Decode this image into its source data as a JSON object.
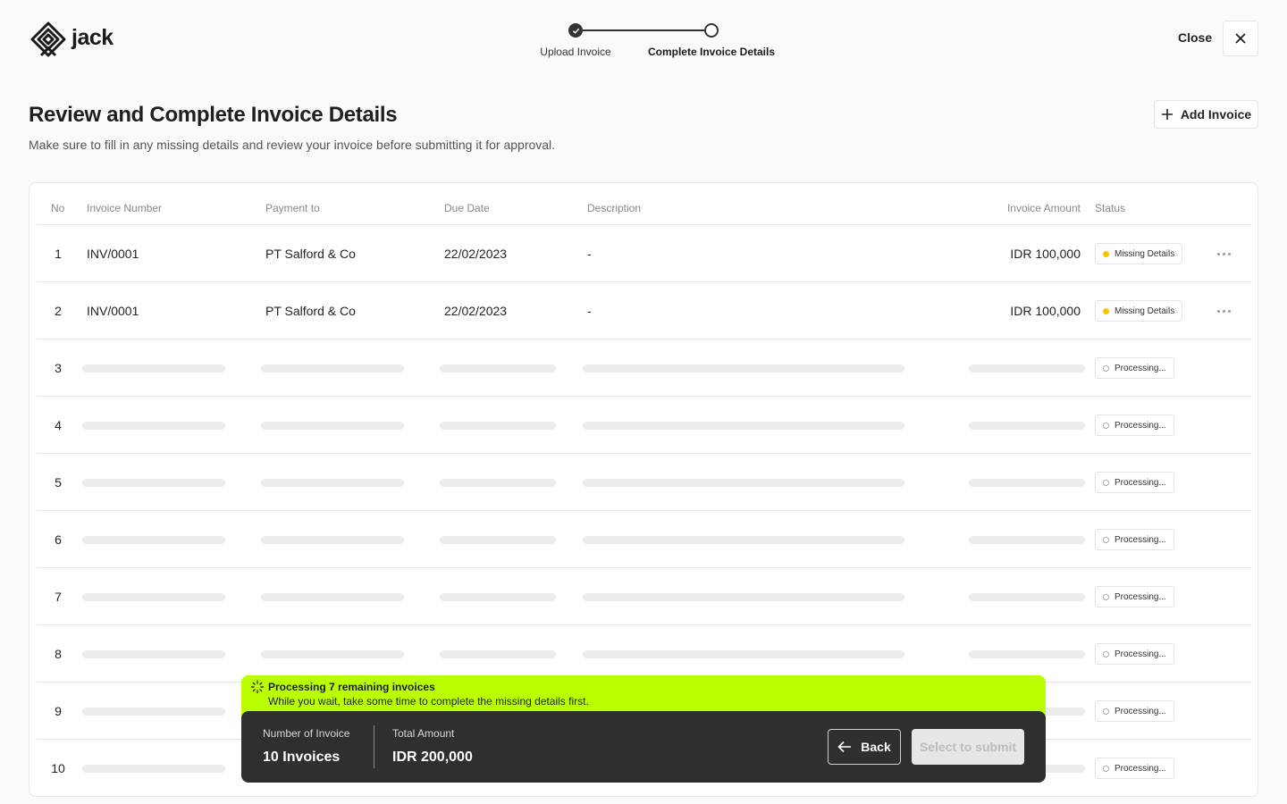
{
  "app": {
    "name": "jack"
  },
  "header": {
    "steps": [
      {
        "label": "Upload Invoice",
        "state": "done"
      },
      {
        "label": "Complete Invoice Details",
        "state": "current"
      }
    ],
    "close_label": "Close"
  },
  "page": {
    "title": "Review and Complete Invoice Details",
    "subtitle": "Make sure to fill in any missing details and review your invoice before submitting it for approval.",
    "add_button": "Add Invoice"
  },
  "table": {
    "columns": [
      "No",
      "Invoice Number",
      "Payment to",
      "Due Date",
      "Description",
      "Invoice Amount",
      "Status"
    ],
    "rows": [
      {
        "no": "1",
        "invoice_number": "INV/0001",
        "payment_to": "PT Salford & Co",
        "due_date": "22/02/2023",
        "description": "-",
        "amount": "IDR 100,000",
        "status": "Missing Details"
      },
      {
        "no": "2",
        "invoice_number": "INV/0001",
        "payment_to": "PT Salford & Co",
        "due_date": "22/02/2023",
        "description": "-",
        "amount": "IDR 100,000",
        "status": "Missing Details"
      },
      {
        "no": "3",
        "status": "Processing..."
      },
      {
        "no": "4",
        "status": "Processing..."
      },
      {
        "no": "5",
        "status": "Processing..."
      },
      {
        "no": "6",
        "status": "Processing..."
      },
      {
        "no": "7",
        "status": "Processing..."
      },
      {
        "no": "8",
        "status": "Processing..."
      },
      {
        "no": "9",
        "status": "Processing..."
      },
      {
        "no": "10",
        "status": "Processing..."
      }
    ]
  },
  "notice": {
    "title": "Processing 7 remaining invoices",
    "subtitle": "While you wait, take some time to complete the missing details first."
  },
  "summary": {
    "count_label": "Number of Invoice",
    "count_value": "10 Invoices",
    "total_label": "Total Amount",
    "total_value": "IDR 200,000",
    "back_label": "Back",
    "submit_label": "Select to submit"
  },
  "colors": {
    "accent": "#baff00",
    "missing": "#f5c400",
    "dark_bar": "#2f2f2f"
  }
}
